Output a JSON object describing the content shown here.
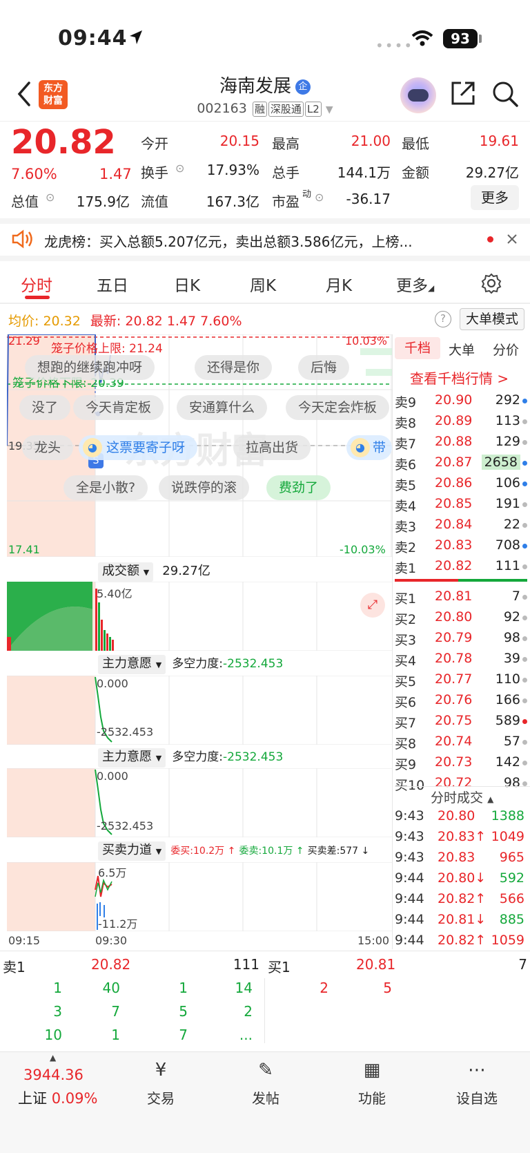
{
  "status": {
    "time": "09:44",
    "battery": "93"
  },
  "header": {
    "logo_line1": "东方",
    "logo_line2": "财富",
    "title": "海南发展",
    "title_badge": "企",
    "code": "002163",
    "tags": [
      "融",
      "深股通",
      "L2"
    ]
  },
  "quote": {
    "price": "20.82",
    "change_pct": "7.60%",
    "change": "1.47",
    "fields": [
      {
        "label": "今开",
        "value": "20.15",
        "color": "#e8262a"
      },
      {
        "label": "最高",
        "value": "21.00",
        "color": "#e8262a"
      },
      {
        "label": "最低",
        "value": "19.61",
        "color": "#e8262a"
      },
      {
        "label": "换手",
        "value": "17.93%",
        "color": "#222"
      },
      {
        "label": "总手",
        "value": "144.1万",
        "color": "#222"
      },
      {
        "label": "金额",
        "value": "29.27亿",
        "color": "#222"
      },
      {
        "label": "总值",
        "value": "175.9亿",
        "color": "#222"
      },
      {
        "label": "流值",
        "value": "167.3亿",
        "color": "#222"
      },
      {
        "label": "市盈",
        "value": "-36.17",
        "color": "#222"
      }
    ],
    "pe_sup": "动",
    "more_label": "更多"
  },
  "ticker": {
    "text": "龙虎榜：买入总额5.207亿元，卖出总额3.586亿元，上榜..."
  },
  "tabs": [
    "分时",
    "五日",
    "日K",
    "周K",
    "月K",
    "更多"
  ],
  "chart_info": {
    "avg_label": "均价:",
    "avg_value": "20.32",
    "latest_label": "最新:",
    "latest_value": "20.82",
    "latest_change": "1.47",
    "latest_pct": "7.60%",
    "mode_button": "大单模式"
  },
  "chart_data": {
    "type": "line",
    "title": "",
    "x_labels": [
      "09:15",
      "09:30",
      "15:00"
    ],
    "y_top_left": "21.29",
    "y_mid_left": "19.35",
    "y_bottom_left": "17.41",
    "y_top_right": "10.03%",
    "y_bottom_right": "-10.03%",
    "upper_limit_label": "笼子价格上限: 21.24",
    "lower_limit_label": "笼子价格下限: 20.39",
    "ylim": [
      17.41,
      21.29
    ],
    "series": [
      {
        "values": [
          19.35,
          20.9,
          20.3,
          20.6,
          20.4,
          20.82
        ]
      }
    ]
  },
  "danmaku": [
    "想跑的继续跑冲呀",
    "还得是你",
    "后悔",
    "没了",
    "今天肯定板",
    "安通算什么",
    "今天定会炸板",
    "龙头",
    "这票要寄子呀",
    "拉高出货",
    "带",
    "全是小散?",
    "说跌停的滚",
    "费劲了"
  ],
  "subcharts": {
    "volume": {
      "label": "成交额",
      "total": "29.27亿",
      "scale": "5.40亿"
    },
    "main1": {
      "label": "主力意愿",
      "force_label": "多空力度:",
      "force_value": "-2532.453",
      "top": "0.000",
      "bottom": "-2532.453"
    },
    "main2": {
      "label": "主力意愿",
      "force_label": "多空力度:",
      "force_value": "-2532.453",
      "top": "0.000",
      "bottom": "-2532.453"
    },
    "bs": {
      "label": "买卖力道",
      "buy": "委买:10.2万 ↑",
      "sell": "委卖:10.1万 ↑",
      "diff": "买卖差:577 ↓",
      "top": "6.5万",
      "bottom": "-11.2万"
    }
  },
  "orderbook": {
    "tabs": [
      "千档",
      "大单",
      "分价"
    ],
    "link": "查看千档行情 >",
    "asks": [
      {
        "n": "卖9",
        "p": "20.90",
        "v": "292",
        "dot": "#2f7fe8"
      },
      {
        "n": "卖8",
        "p": "20.89",
        "v": "113",
        "dot": "#bbb"
      },
      {
        "n": "卖7",
        "p": "20.88",
        "v": "129",
        "dot": "#bbb"
      },
      {
        "n": "卖6",
        "p": "20.87",
        "v": "2658",
        "dot": "#2f7fe8"
      },
      {
        "n": "卖5",
        "p": "20.86",
        "v": "106",
        "dot": "#2f7fe8"
      },
      {
        "n": "卖4",
        "p": "20.85",
        "v": "191",
        "dot": "#bbb"
      },
      {
        "n": "卖3",
        "p": "20.84",
        "v": "22",
        "dot": "#bbb"
      },
      {
        "n": "卖2",
        "p": "20.83",
        "v": "708",
        "dot": "#2f7fe8"
      },
      {
        "n": "卖1",
        "p": "20.82",
        "v": "111",
        "dot": "#bbb"
      }
    ],
    "bids": [
      {
        "n": "买1",
        "p": "20.81",
        "v": "7",
        "dot": "#bbb"
      },
      {
        "n": "买2",
        "p": "20.80",
        "v": "92",
        "dot": "#bbb"
      },
      {
        "n": "买3",
        "p": "20.79",
        "v": "98",
        "dot": "#bbb"
      },
      {
        "n": "买4",
        "p": "20.78",
        "v": "39",
        "dot": "#bbb"
      },
      {
        "n": "买5",
        "p": "20.77",
        "v": "110",
        "dot": "#bbb"
      },
      {
        "n": "买6",
        "p": "20.76",
        "v": "166",
        "dot": "#bbb"
      },
      {
        "n": "买7",
        "p": "20.75",
        "v": "589",
        "dot": "#e8262a"
      },
      {
        "n": "买8",
        "p": "20.74",
        "v": "57",
        "dot": "#bbb"
      },
      {
        "n": "买9",
        "p": "20.73",
        "v": "142",
        "dot": "#bbb"
      },
      {
        "n": "买10",
        "p": "20.72",
        "v": "98",
        "dot": "#bbb"
      }
    ],
    "ticks_title": "分时成交",
    "ticks": [
      {
        "t": "9:43",
        "p": "20.80",
        "a": "",
        "v": "1388",
        "c": "#e8262a",
        "vc": "#14a83b"
      },
      {
        "t": "9:43",
        "p": "20.83",
        "a": "↑",
        "v": "1049",
        "c": "#e8262a",
        "vc": "#e8262a"
      },
      {
        "t": "9:43",
        "p": "20.83",
        "a": "",
        "v": "965",
        "c": "#e8262a",
        "vc": "#e8262a"
      },
      {
        "t": "9:44",
        "p": "20.80",
        "a": "↓",
        "v": "592",
        "c": "#e8262a",
        "vc": "#14a83b"
      },
      {
        "t": "9:44",
        "p": "20.82",
        "a": "↑",
        "v": "566",
        "c": "#e8262a",
        "vc": "#e8262a"
      },
      {
        "t": "9:44",
        "p": "20.81",
        "a": "↓",
        "v": "885",
        "c": "#e8262a",
        "vc": "#14a83b"
      },
      {
        "t": "9:44",
        "p": "20.82",
        "a": "↑",
        "v": "1059",
        "c": "#e8262a",
        "vc": "#e8262a"
      }
    ]
  },
  "level2": {
    "sell_label": "卖1",
    "sell_price": "20.82",
    "sell_vol": "111",
    "buy_label": "买1",
    "buy_price": "20.81",
    "buy_vol": "7",
    "sell_queue": [
      [
        "1",
        "40",
        "1",
        "14"
      ],
      [
        "3",
        "7",
        "5",
        "2"
      ],
      [
        "10",
        "1",
        "7",
        "..."
      ]
    ],
    "buy_queue": [
      [
        "2",
        "5"
      ]
    ]
  },
  "bottom_nav": {
    "index_value": "3944.36",
    "index_name": "上证",
    "index_pct": "0.09%",
    "items": [
      "交易",
      "发帖",
      "功能",
      "设自选"
    ]
  }
}
